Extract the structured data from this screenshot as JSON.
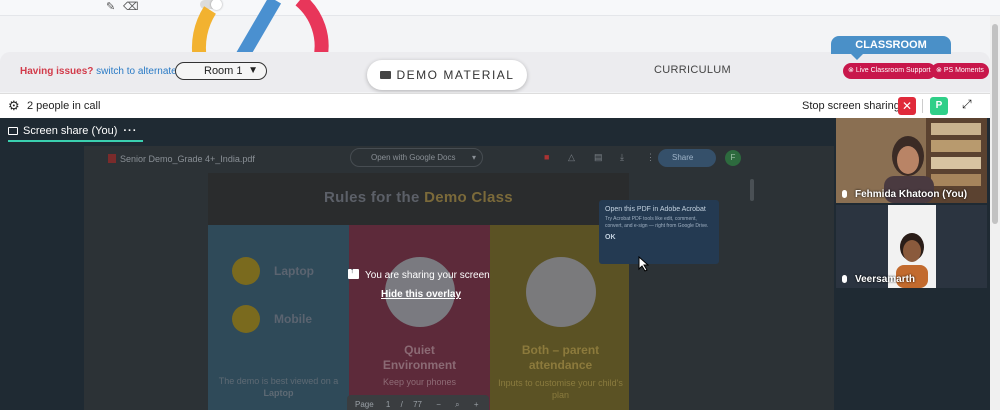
{
  "header": {
    "issues_text": "Having issues?",
    "switch_link": "switch to alternate room",
    "room_select": "Room 1",
    "demo_material": "DEMO MATERIAL",
    "curriculum": "CURRICULUM",
    "classroom_tab": "CLASSROOM",
    "live_support": "Live Classroom Support",
    "ps_moments": "PS Moments"
  },
  "callbar": {
    "people_in_call": "2 people in call",
    "stop_sharing": "Stop screen sharing",
    "participant_initial": "P"
  },
  "stage": {
    "tab_label": "Screen share (You)",
    "overlay_title": "You are sharing your screen",
    "overlay_hide": "Hide this overlay"
  },
  "pdf": {
    "filename": "Senior Demo_Grade 4+_India.pdf",
    "open_with": "Open with Google Docs",
    "share": "Share",
    "avatar_initial": "F",
    "page_label": "Page",
    "page_current": "1",
    "page_sep": "/",
    "page_total": "77",
    "popup_title": "Open this PDF in Adobe Acrobat",
    "popup_body": "Try Acrobat PDF tools like edit, comment, convert, and e-sign — right from Google Drive.",
    "popup_ok": "OK"
  },
  "slide": {
    "title_a": "Rules for the",
    "title_b": "Demo Class",
    "laptop": "Laptop",
    "mobile": "Mobile",
    "demo_best": "The demo is best viewed on a",
    "demo_best_device": "Laptop",
    "quiet_a": "Quiet",
    "quiet_b": "Environment",
    "quiet_sub": "Keep your phones",
    "both_a": "Both – parent",
    "both_b": "attendance",
    "both_sub": "Inputs to customise your child's plan"
  },
  "participants": [
    {
      "name": "Fehmida Khatoon (You)"
    },
    {
      "name": "Veersamarth"
    }
  ],
  "colors": {
    "stage_bg": "#1f2a33",
    "accent_teal": "#3ad0b0",
    "danger_red": "#e02a3a",
    "brand_pink": "#c8174b",
    "classroom_blue": "#4a90c8"
  },
  "icons": [
    "pencil-icon",
    "eraser-icon",
    "folder-icon",
    "gear-icon",
    "close-icon",
    "expand-icon",
    "monitor-icon",
    "more-icon",
    "mic-icon",
    "upload-icon",
    "pointer-cursor-icon"
  ]
}
